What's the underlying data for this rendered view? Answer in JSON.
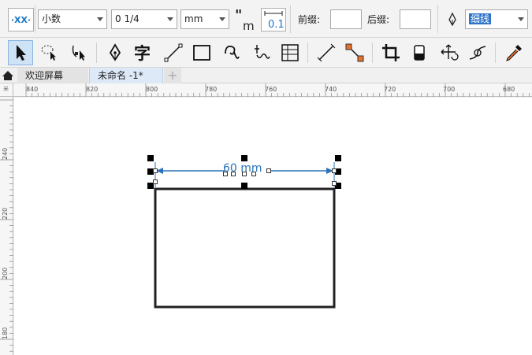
{
  "property_bar": {
    "dimension_style_icon": "dimension-style-icon",
    "style_value": "小数",
    "precision_value": "0 1/4",
    "units_value": "mm",
    "show_units_icon": "show-units-icon",
    "text_position_icon": "text-position-icon",
    "text_position_value": "0.1",
    "prefix_label": "前缀:",
    "prefix_value": "",
    "suffix_label": "后缀:",
    "suffix_value": "",
    "outline_pen_icon": "pen-nib-icon",
    "outline_width_value": "细线"
  },
  "toolbox": {
    "tools": [
      {
        "icon": "pick-tool-icon"
      },
      {
        "icon": "freehand-pick-icon"
      },
      {
        "icon": "shape-tool-icon"
      },
      {
        "icon": "pen-tool-icon"
      },
      {
        "icon": "text-tool-icon"
      },
      {
        "icon": "line-tool-icon"
      },
      {
        "icon": "rectangle-tool-icon"
      },
      {
        "icon": "spiral-tool-icon"
      },
      {
        "icon": "artistic-media-icon"
      },
      {
        "icon": "table-tool-icon"
      },
      {
        "icon": "dimension-tool-icon"
      },
      {
        "icon": "connector-tool-icon"
      },
      {
        "icon": "crop-tool-icon"
      },
      {
        "icon": "eraser-tool-icon"
      },
      {
        "icon": "transform-tool-icon"
      },
      {
        "icon": "blend-tool-icon"
      },
      {
        "icon": "eyedropper-tool-icon"
      }
    ]
  },
  "tabs": {
    "home_icon": "home-icon",
    "welcome": "欢迎屏幕",
    "document": "未命名 -1*",
    "add_icon": "plus-icon",
    "add_symbol": "+"
  },
  "rulers": {
    "horizontal_labels": [
      "840",
      "820",
      "800",
      "780",
      "760",
      "740",
      "720",
      "700",
      "680"
    ],
    "vertical_labels": [
      "240",
      "220",
      "200",
      "180"
    ],
    "unit_label": "米"
  },
  "canvas": {
    "dimension_text": "60 mm",
    "dimension_color": "#2b72b8"
  }
}
